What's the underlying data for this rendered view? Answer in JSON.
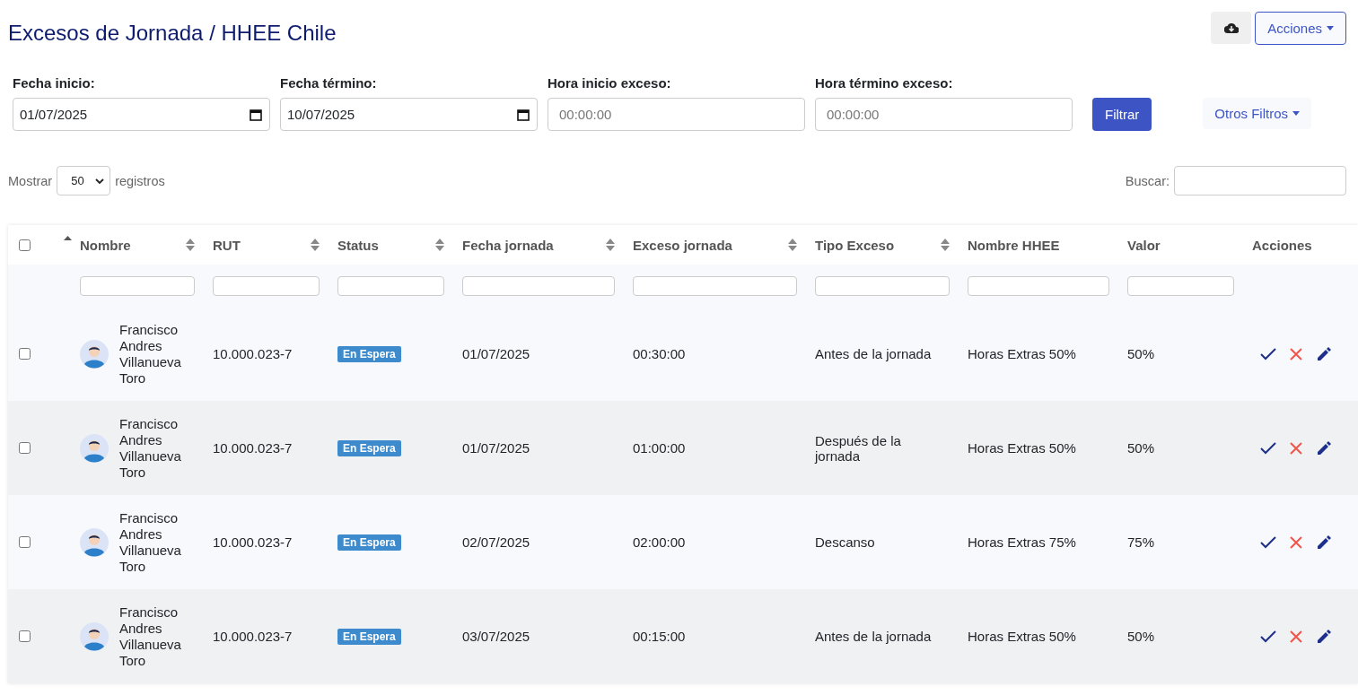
{
  "title": "Excesos de Jornada / HHEE Chile",
  "toolbar": {
    "actions_label": "Acciones"
  },
  "filters": [
    {
      "label": "Fecha inicio:",
      "kind": "date",
      "value": "01/07/2025"
    },
    {
      "label": "Fecha término:",
      "kind": "date",
      "value": "10/07/2025"
    },
    {
      "label": "Hora inicio exceso:",
      "kind": "time",
      "placeholder": "00:00:00"
    },
    {
      "label": "Hora término exceso:",
      "kind": "time",
      "placeholder": "00:00:00"
    }
  ],
  "filter_button": "Filtrar",
  "other_filters": "Otros Filtros",
  "length": {
    "before": "Mostrar",
    "value": "50",
    "after": "registros"
  },
  "search": {
    "label": "Buscar:"
  },
  "table": {
    "select_all": {
      "checked": false
    },
    "columns": [
      {
        "label": "Nombre",
        "sortable": true,
        "sorted": true
      },
      {
        "label": "RUT",
        "sortable": true,
        "sorted": false
      },
      {
        "label": "Status",
        "sortable": true,
        "sorted": false
      },
      {
        "label": "Fecha jornada",
        "sortable": true,
        "sorted": false
      },
      {
        "label": "Exceso jornada",
        "sortable": true,
        "sorted": false
      },
      {
        "label": "Tipo Exceso",
        "sortable": true,
        "sorted": false
      },
      {
        "label": "Nombre HHEE",
        "sortable": false,
        "sorted": false
      },
      {
        "label": "Valor",
        "sortable": false,
        "sorted": false
      },
      {
        "label": "Acciones",
        "sortable": false,
        "sorted": false
      }
    ],
    "rows": [
      {
        "checked": false,
        "name": "Francisco Andres Villanueva Toro",
        "rut": "10.000.023-7",
        "status": "En Espera",
        "date": "01/07/2025",
        "excess": "00:30:00",
        "type": "Antes de la jornada",
        "hhee": "Horas Extras 50%",
        "value": "50%"
      },
      {
        "checked": false,
        "name": "Francisco Andres Villanueva Toro",
        "rut": "10.000.023-7",
        "status": "En Espera",
        "date": "01/07/2025",
        "excess": "01:00:00",
        "type": "Después de la jornada",
        "hhee": "Horas Extras 50%",
        "value": "50%"
      },
      {
        "checked": false,
        "name": "Francisco Andres Villanueva Toro",
        "rut": "10.000.023-7",
        "status": "En Espera",
        "date": "02/07/2025",
        "excess": "02:00:00",
        "type": "Descanso",
        "hhee": "Horas Extras 75%",
        "value": "75%"
      },
      {
        "checked": false,
        "name": "Francisco Andres Villanueva Toro",
        "rut": "10.000.023-7",
        "status": "En Espera",
        "date": "03/07/2025",
        "excess": "00:15:00",
        "type": "Antes de la jornada",
        "hhee": "Horas Extras 50%",
        "value": "50%"
      }
    ]
  }
}
